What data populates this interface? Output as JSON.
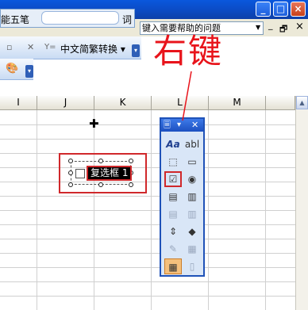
{
  "ime": {
    "name": "万能五笔",
    "placeholder": "",
    "word_button": "词"
  },
  "menubar": {
    "help_placeholder": "键入需要帮助的问题",
    "mdi_min": "_",
    "mdi_restore": "🗗",
    "mdi_close": "×"
  },
  "window": {
    "min": "_",
    "max": "□",
    "close": "×"
  },
  "toolbar": {
    "convert_label": "中文简繁转换 ▾",
    "chevron": "▾"
  },
  "sheet": {
    "columns": [
      "I",
      "J",
      "K",
      "L",
      "M"
    ]
  },
  "checkbox_control": {
    "label": "复选框 1"
  },
  "forms_toolbar": {
    "title_icons": [
      "🗏",
      "▾",
      "✕"
    ],
    "tools": [
      {
        "name": "label-tool",
        "glyph": "Aa"
      },
      {
        "name": "edit-box-tool",
        "glyph": "abl"
      },
      {
        "name": "group-box-tool",
        "glyph": "⬚"
      },
      {
        "name": "button-tool",
        "glyph": "▭"
      },
      {
        "name": "checkbox-tool",
        "glyph": "☑"
      },
      {
        "name": "option-button-tool",
        "glyph": "◉"
      },
      {
        "name": "list-box-tool",
        "glyph": "▤"
      },
      {
        "name": "combo-box-tool",
        "glyph": "▥"
      },
      {
        "name": "combo-list-edit-tool",
        "glyph": "▤"
      },
      {
        "name": "combo-dropdown-edit-tool",
        "glyph": "▥"
      },
      {
        "name": "scroll-bar-tool",
        "glyph": "⇕"
      },
      {
        "name": "spinner-tool",
        "glyph": "◆"
      },
      {
        "name": "control-properties-tool",
        "glyph": "✎"
      },
      {
        "name": "edit-code-tool",
        "glyph": "▦"
      },
      {
        "name": "toggle-grid-tool",
        "glyph": "▦"
      },
      {
        "name": "run-dialog-tool",
        "glyph": "▯"
      }
    ]
  },
  "annotation": {
    "text": "右键"
  }
}
